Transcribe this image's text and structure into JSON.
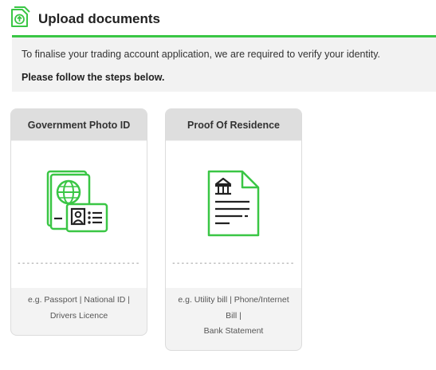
{
  "header": {
    "title": "Upload documents",
    "icon": "upload-document-icon"
  },
  "intro": {
    "line1": "To finalise your trading account application, we are required to verify your identity.",
    "line2": "Please follow the steps below."
  },
  "cards": [
    {
      "title": "Government Photo ID",
      "icon": "passport-id-icon",
      "dashes": "------------------------------",
      "hint_lines": [
        "e.g. Passport | National ID |",
        "Drivers Licence"
      ]
    },
    {
      "title": "Proof Of Residence",
      "icon": "residence-document-icon",
      "dashes": "------------------------------",
      "hint_lines": [
        "e.g. Utility bill | Phone/Internet",
        "Bill |",
        "Bank Statement"
      ]
    }
  ],
  "colors": {
    "accent": "#3ac645",
    "info_bg": "#f2f2f2",
    "card_header_bg": "#dedede"
  }
}
